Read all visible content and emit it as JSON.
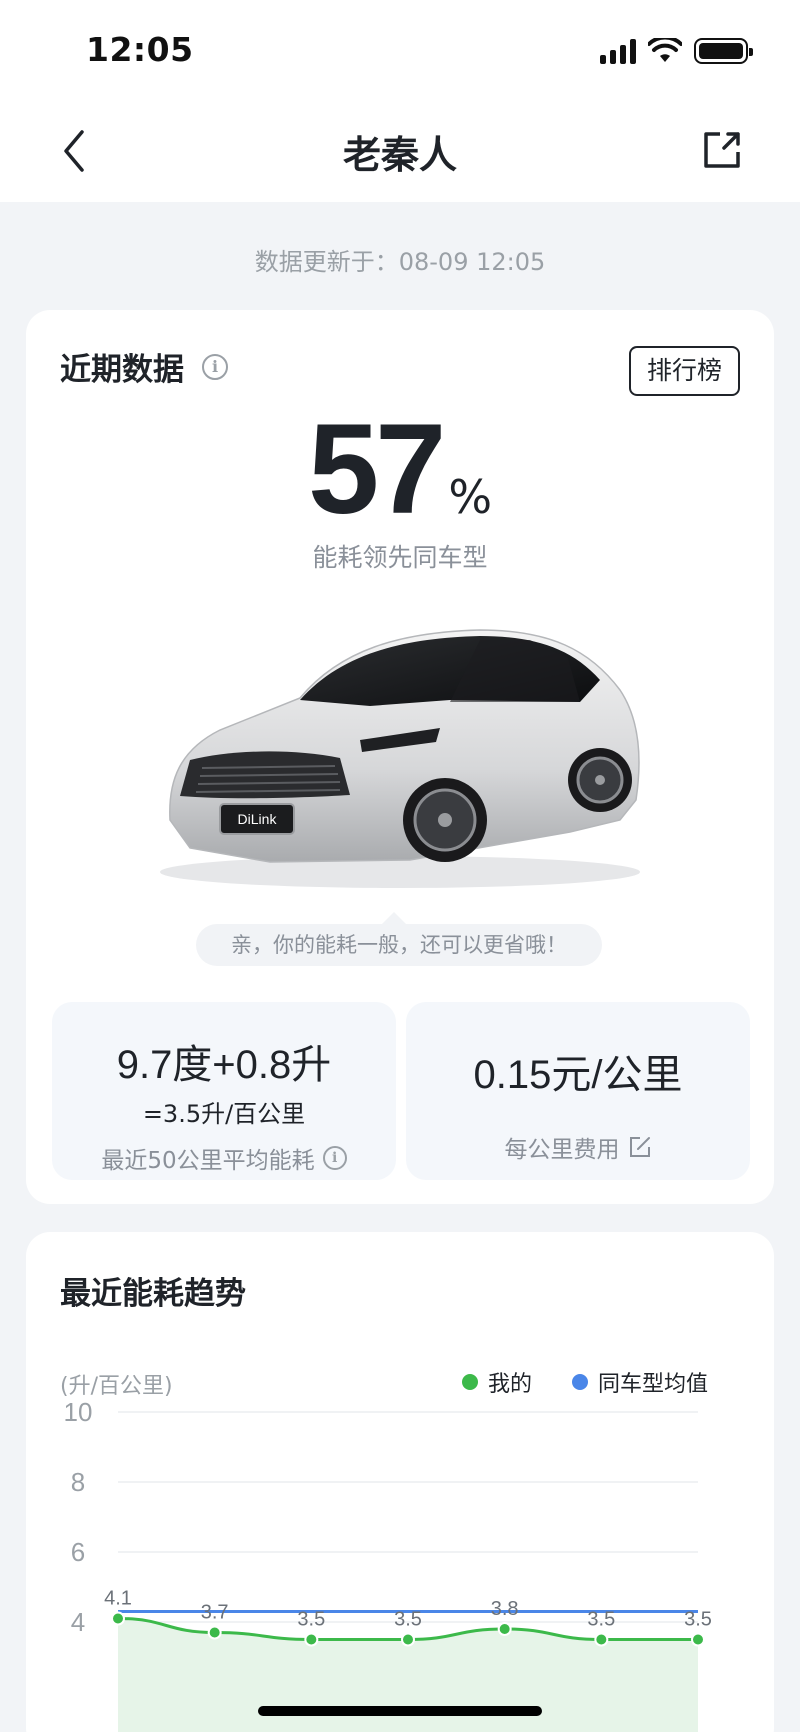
{
  "status": {
    "time": "12:05"
  },
  "nav": {
    "title": "老秦人"
  },
  "updated": "数据更新于：08-09 12:05",
  "recent": {
    "title": "近期数据",
    "rank_label": "排行榜",
    "percent": "57",
    "percent_unit": "%",
    "percent_label": "能耗领先同车型",
    "tip": "亲，你的能耗一般，还可以更省哦！",
    "car_plate_text": "DiLink",
    "consumption_main": "9.7度+0.8升",
    "consumption_sub": "=3.5升/百公里",
    "consumption_label": "最近50公里平均能耗",
    "cost_main": "0.15元/公里",
    "cost_label": "每公里费用"
  },
  "trend": {
    "title": "最近能耗趋势"
  },
  "colors": {
    "mine": "#3cb94a",
    "average": "#4a86e8",
    "fill": "#e3f3e6"
  },
  "chart_data": {
    "type": "line",
    "ylabel": "(升/百公里)",
    "yticks": [
      "10",
      "8",
      "6",
      "4"
    ],
    "ylim": [
      2,
      10
    ],
    "x": [
      1,
      2,
      3,
      4,
      5,
      6,
      7
    ],
    "series": [
      {
        "name": "我的",
        "values": [
          4.1,
          3.7,
          3.5,
          3.5,
          3.8,
          3.5,
          3.5
        ],
        "labels": [
          "4.1",
          "3.7",
          "3.5",
          "3.5",
          "3.8",
          "3.5",
          "3.5"
        ]
      },
      {
        "name": "同车型均值",
        "values": [
          4.3,
          4.3,
          4.3,
          4.3,
          4.3,
          4.3,
          4.3
        ]
      }
    ],
    "grid": true,
    "legend": "top-right"
  }
}
